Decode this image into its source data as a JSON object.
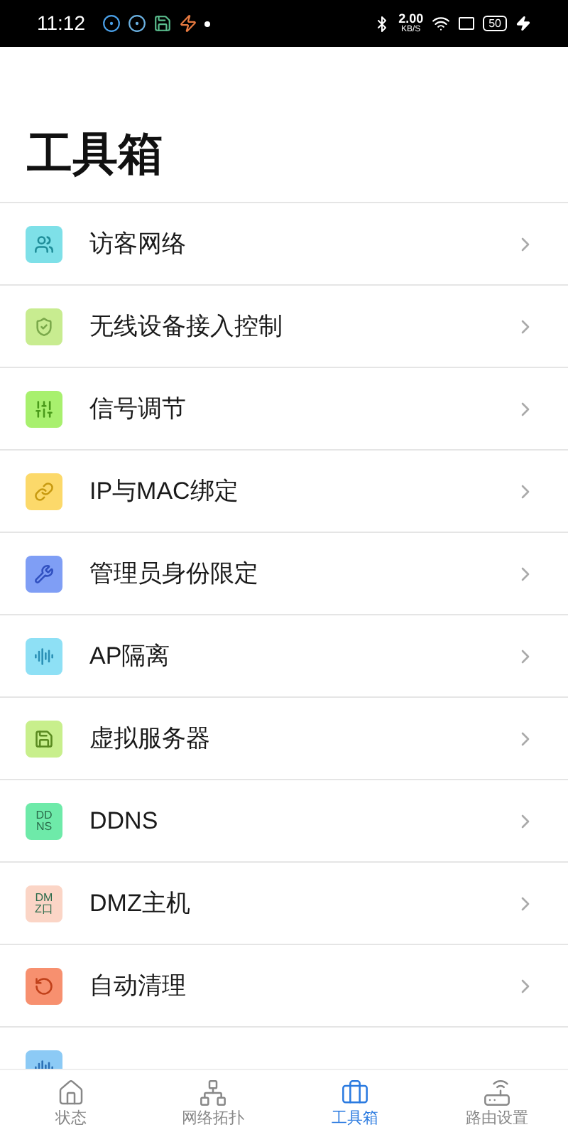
{
  "status_bar": {
    "time": "11:12",
    "speed_value": "2.00",
    "speed_unit": "KB/S",
    "battery": "50"
  },
  "title": "工具箱",
  "items": [
    {
      "label": "访客网络",
      "color": "#7ee0e8",
      "kind": "glyph"
    },
    {
      "label": "无线设备接入控制",
      "color": "#c8ec90",
      "kind": "glyph"
    },
    {
      "label": "信号调节",
      "color": "#a8f06e",
      "kind": "glyph"
    },
    {
      "label": "IP与MAC绑定",
      "color": "#fcd96a",
      "kind": "glyph"
    },
    {
      "label": "管理员身份限定",
      "color": "#7f9ef5",
      "kind": "glyph"
    },
    {
      "label": "AP隔离",
      "color": "#8ee0f5",
      "kind": "glyph"
    },
    {
      "label": "虚拟服务器",
      "color": "#c8ef8c",
      "kind": "glyph"
    },
    {
      "label": "DDNS",
      "color": "#6eeaa9",
      "kind": "text",
      "icon_text": [
        "DD",
        "NS"
      ]
    },
    {
      "label": "DMZ主机",
      "color": "#fbd5c6",
      "kind": "text",
      "icon_text": [
        "DM",
        "Z口"
      ]
    },
    {
      "label": "自动清理",
      "color": "#f7906f",
      "kind": "glyph"
    },
    {
      "color": "#8ccaf5",
      "kind": "glyph"
    }
  ],
  "tabs": [
    {
      "label": "状态",
      "selected": false
    },
    {
      "label": "网络拓扑",
      "selected": false
    },
    {
      "label": "工具箱",
      "selected": true
    },
    {
      "label": "路由设置",
      "selected": false
    }
  ]
}
